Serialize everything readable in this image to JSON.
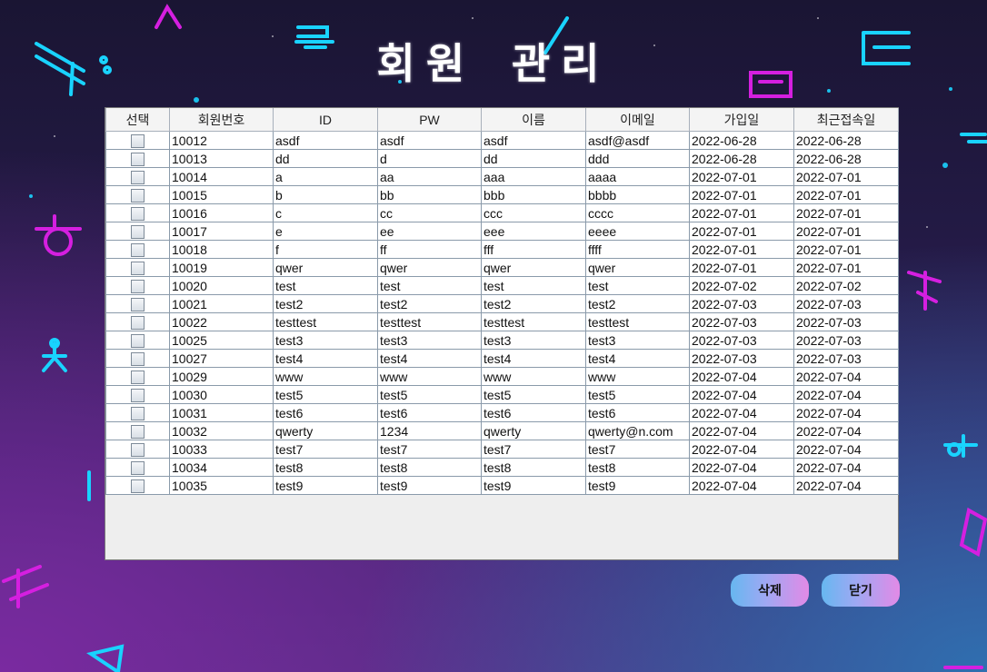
{
  "title": "회원 관리",
  "columns": [
    "선택",
    "회원번호",
    "ID",
    "PW",
    "이름",
    "이메일",
    "가입일",
    "최근접속일"
  ],
  "rows": [
    [
      "10012",
      "asdf",
      "asdf",
      "asdf",
      "asdf@asdf",
      "2022-06-28",
      "2022-06-28"
    ],
    [
      "10013",
      "dd",
      "d",
      "dd",
      "ddd",
      "2022-06-28",
      "2022-06-28"
    ],
    [
      "10014",
      "a",
      "aa",
      "aaa",
      "aaaa",
      "2022-07-01",
      "2022-07-01"
    ],
    [
      "10015",
      "b",
      "bb",
      "bbb",
      "bbbb",
      "2022-07-01",
      "2022-07-01"
    ],
    [
      "10016",
      "c",
      "cc",
      "ccc",
      "cccc",
      "2022-07-01",
      "2022-07-01"
    ],
    [
      "10017",
      "e",
      "ee",
      "eee",
      "eeee",
      "2022-07-01",
      "2022-07-01"
    ],
    [
      "10018",
      "f",
      "ff",
      "fff",
      "ffff",
      "2022-07-01",
      "2022-07-01"
    ],
    [
      "10019",
      "qwer",
      "qwer",
      "qwer",
      "qwer",
      "2022-07-01",
      "2022-07-01"
    ],
    [
      "10020",
      "test",
      "test",
      "test",
      "test",
      "2022-07-02",
      "2022-07-02"
    ],
    [
      "10021",
      "test2",
      "test2",
      "test2",
      "test2",
      "2022-07-03",
      "2022-07-03"
    ],
    [
      "10022",
      "testtest",
      "testtest",
      "testtest",
      "testtest",
      "2022-07-03",
      "2022-07-03"
    ],
    [
      "10025",
      "test3",
      "test3",
      "test3",
      "test3",
      "2022-07-03",
      "2022-07-03"
    ],
    [
      "10027",
      "test4",
      "test4",
      "test4",
      "test4",
      "2022-07-03",
      "2022-07-03"
    ],
    [
      "10029",
      "www",
      "www",
      "www",
      "www",
      "2022-07-04",
      "2022-07-04"
    ],
    [
      "10030",
      "test5",
      "test5",
      "test5",
      "test5",
      "2022-07-04",
      "2022-07-04"
    ],
    [
      "10031",
      "test6",
      "test6",
      "test6",
      "test6",
      "2022-07-04",
      "2022-07-04"
    ],
    [
      "10032",
      "qwerty",
      "1234",
      "qwerty",
      "qwerty@n.com",
      "2022-07-04",
      "2022-07-04"
    ],
    [
      "10033",
      "test7",
      "test7",
      "test7",
      "test7",
      "2022-07-04",
      "2022-07-04"
    ],
    [
      "10034",
      "test8",
      "test8",
      "test8",
      "test8",
      "2022-07-04",
      "2022-07-04"
    ],
    [
      "10035",
      "test9",
      "test9",
      "test9",
      "test9",
      "2022-07-04",
      "2022-07-04"
    ]
  ],
  "buttons": {
    "delete": "삭제",
    "close": "닫기"
  },
  "icons": {
    "row_checkbox": "checkbox-icon"
  },
  "colors": {
    "neon_cyan": "#19d3ff",
    "neon_magenta": "#d51fe0",
    "button_gradient_start": "#67b7f0",
    "button_gradient_end": "#e28ae6"
  }
}
